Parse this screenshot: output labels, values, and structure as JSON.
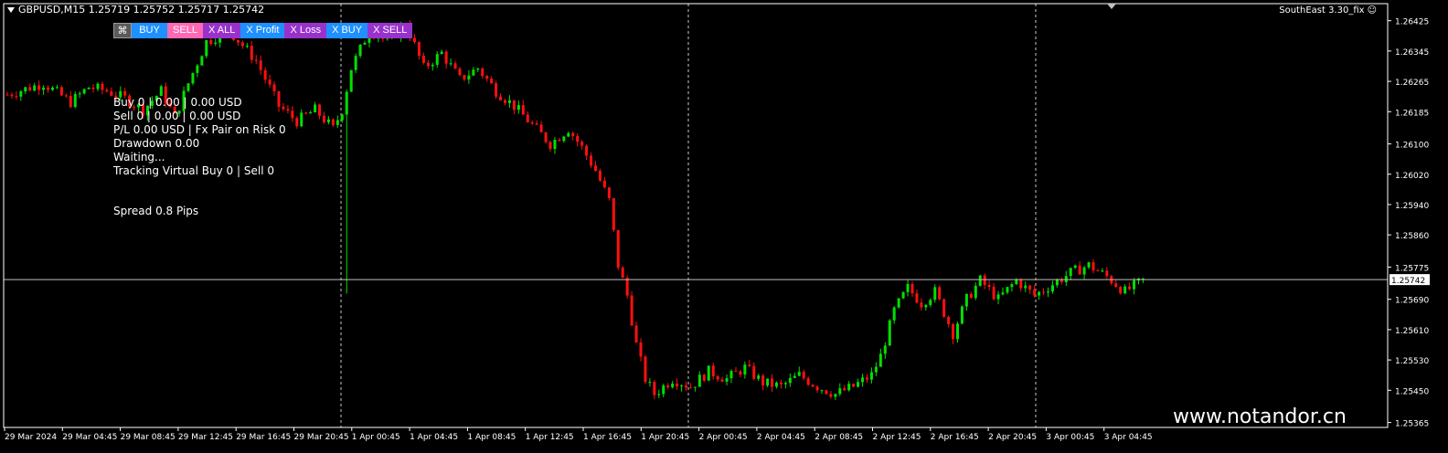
{
  "window": {
    "title": "GBPUSD,M15  1.25719 1.25752 1.25717 1.25742",
    "ea_label": "SouthEast 3.30_fix",
    "ea_icon": "smiley-icon"
  },
  "toolbar": {
    "buy": "BUY",
    "sell": "SELL",
    "x_all": "X ALL",
    "x_profit": "X Profit",
    "x_loss": "X Loss",
    "x_buy": "X BUY",
    "x_sell": "X SELL"
  },
  "info": {
    "line1": "Buy 0 | 0.00 | 0.00 USD",
    "line2": "Sell 0 | 0.00 | 0.00 USD",
    "line3": "P/L 0.00 USD | Fx Pair on Risk 0",
    "line4": "Drawdown 0.00",
    "line5": "Waiting...",
    "line6": "Tracking Virtual Buy 0 | Sell 0",
    "spread": "Spread 0.8 Pips"
  },
  "watermark": "www.notandor.cn",
  "colors": {
    "background": "#000000",
    "bull": "#00e000",
    "bear": "#ff1010",
    "axis": "#ffffff",
    "grid": "#c8c8c8",
    "price_line": "#c0c0c0"
  },
  "chart_data": {
    "type": "candlestick",
    "symbol": "GBPUSD",
    "timeframe": "M15",
    "bid_line": 1.25742,
    "current_price_label": "1.25742",
    "ylim": [
      1.25352,
      1.2647
    ],
    "y_ticks": [
      "1.26425",
      "1.26345",
      "1.26265",
      "1.26185",
      "1.26100",
      "1.26020",
      "1.25940",
      "1.25860",
      "1.25775",
      "1.25690",
      "1.25610",
      "1.25530",
      "1.25450",
      "1.25365"
    ],
    "x_ticks": [
      "29 Mar 2024",
      "29 Mar 04:45",
      "29 Mar 08:45",
      "29 Mar 12:45",
      "29 Mar 16:45",
      "29 Mar 20:45",
      "1 Apr 00:45",
      "1 Apr 04:45",
      "1 Apr 08:45",
      "1 Apr 12:45",
      "1 Apr 16:45",
      "1 Apr 20:45",
      "2 Apr 00:45",
      "2 Apr 04:45",
      "2 Apr 08:45",
      "2 Apr 12:45",
      "2 Apr 16:45",
      "2 Apr 20:45",
      "3 Apr 00:45",
      "3 Apr 04:45"
    ],
    "day_separators": [
      "1 Apr 00:00",
      "2 Apr 00:00",
      "3 Apr 00:00"
    ],
    "anchors": [
      [
        0,
        1.2623
      ],
      [
        8,
        1.2626
      ],
      [
        14,
        1.2621
      ],
      [
        18,
        1.2625
      ],
      [
        22,
        1.2624
      ],
      [
        26,
        1.2622
      ],
      [
        30,
        1.2619
      ],
      [
        34,
        1.2624
      ],
      [
        37,
        1.2617
      ],
      [
        40,
        1.2626
      ],
      [
        44,
        1.2637
      ],
      [
        49,
        1.264
      ],
      [
        55,
        1.2632
      ],
      [
        60,
        1.262
      ],
      [
        64,
        1.2616
      ],
      [
        68,
        1.2619
      ],
      [
        72,
        1.2614
      ],
      [
        74,
        1.2619
      ],
      [
        76,
        1.263
      ],
      [
        80,
        1.264
      ],
      [
        84,
        1.2637
      ],
      [
        88,
        1.2642
      ],
      [
        92,
        1.263
      ],
      [
        96,
        1.2634
      ],
      [
        100,
        1.2627
      ],
      [
        104,
        1.263
      ],
      [
        108,
        1.2624
      ],
      [
        112,
        1.262
      ],
      [
        116,
        1.2615
      ],
      [
        120,
        1.261
      ],
      [
        124,
        1.2614
      ],
      [
        127,
        1.2609
      ],
      [
        130,
        1.2603
      ],
      [
        133,
        1.2595
      ],
      [
        135,
        1.2578
      ],
      [
        137,
        1.257
      ],
      [
        139,
        1.2557
      ],
      [
        141,
        1.2548
      ],
      [
        143,
        1.2544
      ],
      [
        147,
        1.2548
      ],
      [
        151,
        1.2546
      ],
      [
        155,
        1.255
      ],
      [
        159,
        1.2548
      ],
      [
        163,
        1.2551
      ],
      [
        167,
        1.2547
      ],
      [
        171,
        1.2546
      ],
      [
        175,
        1.2549
      ],
      [
        179,
        1.2546
      ],
      [
        183,
        1.2544
      ],
      [
        187,
        1.2546
      ],
      [
        191,
        1.2549
      ],
      [
        193,
        1.2554
      ],
      [
        196,
        1.2566
      ],
      [
        199,
        1.2572
      ],
      [
        202,
        1.2568
      ],
      [
        205,
        1.2571
      ],
      [
        209,
        1.256
      ],
      [
        212,
        1.2569
      ],
      [
        215,
        1.2574
      ],
      [
        219,
        1.2569
      ],
      [
        223,
        1.2574
      ],
      [
        227,
        1.257
      ],
      [
        231,
        1.2573
      ],
      [
        235,
        1.2576
      ],
      [
        239,
        1.2578
      ],
      [
        243,
        1.2575
      ],
      [
        247,
        1.2571
      ],
      [
        251,
        1.2574
      ]
    ],
    "spikes": [
      {
        "index": 75,
        "low": 1.25705
      },
      {
        "index": 138,
        "low": 1.2568
      }
    ]
  }
}
